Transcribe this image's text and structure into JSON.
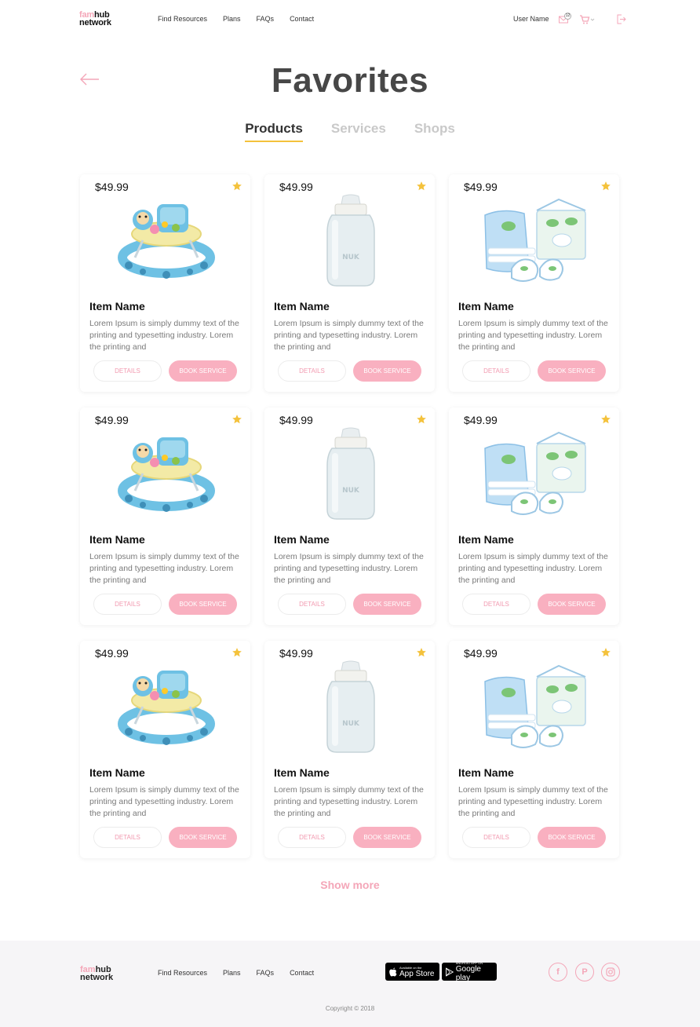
{
  "header": {
    "logo_line1_a": "fam",
    "logo_line1_b": "hub",
    "logo_line2": "network",
    "nav": [
      "Find Resources",
      "Plans",
      "FAQs",
      "Contact"
    ],
    "user_name": "User Name",
    "mail_badge": "12"
  },
  "page": {
    "title": "Favorites",
    "tabs": [
      "Products",
      "Services",
      "Shops"
    ],
    "active_tab": "Products"
  },
  "cards": [
    {
      "price": "$49.99",
      "image": "baby-walker",
      "name": "Item Name",
      "desc": "Lorem Ipsum is simply dummy text of the printing and typesetting industry. Lorem the printing and",
      "details": "DETAILS",
      "book": "BOOK SERVICE"
    },
    {
      "price": "$49.99",
      "image": "baby-bottle",
      "name": "Item Name",
      "desc": "Lorem Ipsum is simply dummy text of the printing and typesetting industry. Lorem the printing and",
      "details": "DETAILS",
      "book": "BOOK SERVICE"
    },
    {
      "price": "$49.99",
      "image": "baby-clothes-set",
      "name": "Item Name",
      "desc": "Lorem Ipsum is simply dummy text of the printing and typesetting industry. Lorem the printing and",
      "details": "DETAILS",
      "book": "BOOK SERVICE"
    },
    {
      "price": "$49.99",
      "image": "baby-walker",
      "name": "Item Name",
      "desc": "Lorem Ipsum is simply dummy text of the printing and typesetting industry. Lorem the printing and",
      "details": "DETAILS",
      "book": "BOOK SERVICE"
    },
    {
      "price": "$49.99",
      "image": "baby-bottle",
      "name": "Item Name",
      "desc": "Lorem Ipsum is simply dummy text of the printing and typesetting industry. Lorem the printing and",
      "details": "DETAILS",
      "book": "BOOK SERVICE"
    },
    {
      "price": "$49.99",
      "image": "baby-clothes-set",
      "name": "Item Name",
      "desc": "Lorem Ipsum is simply dummy text of the printing and typesetting industry. Lorem the printing and",
      "details": "DETAILS",
      "book": "BOOK SERVICE"
    },
    {
      "price": "$49.99",
      "image": "baby-walker",
      "name": "Item Name",
      "desc": "Lorem Ipsum is simply dummy text of the printing and typesetting industry. Lorem the printing and",
      "details": "DETAILS",
      "book": "BOOK SERVICE"
    },
    {
      "price": "$49.99",
      "image": "baby-bottle",
      "name": "Item Name",
      "desc": "Lorem Ipsum is simply dummy text of the printing and typesetting industry. Lorem the printing and",
      "details": "DETAILS",
      "book": "BOOK SERVICE"
    },
    {
      "price": "$49.99",
      "image": "baby-clothes-set",
      "name": "Item Name",
      "desc": "Lorem Ipsum is simply dummy text of the printing and typesetting industry. Lorem the printing and",
      "details": "DETAILS",
      "book": "BOOK SERVICE"
    }
  ],
  "show_more": "Show more",
  "footer": {
    "nav": [
      "Find Resources",
      "Plans",
      "FAQs",
      "Contact"
    ],
    "app_store_small": "Available on the",
    "app_store_big": "App Store",
    "google_small": "ANDROID APP ON",
    "google_big": "Google play",
    "social": [
      "facebook-icon",
      "pinterest-icon",
      "instagram-icon"
    ],
    "copyright": "Copyright © 2018"
  },
  "colors": {
    "accent": "#f4a6b8",
    "button": "#f9b0c0",
    "star": "#f4c23c",
    "tab_underline": "#f4c23c"
  }
}
